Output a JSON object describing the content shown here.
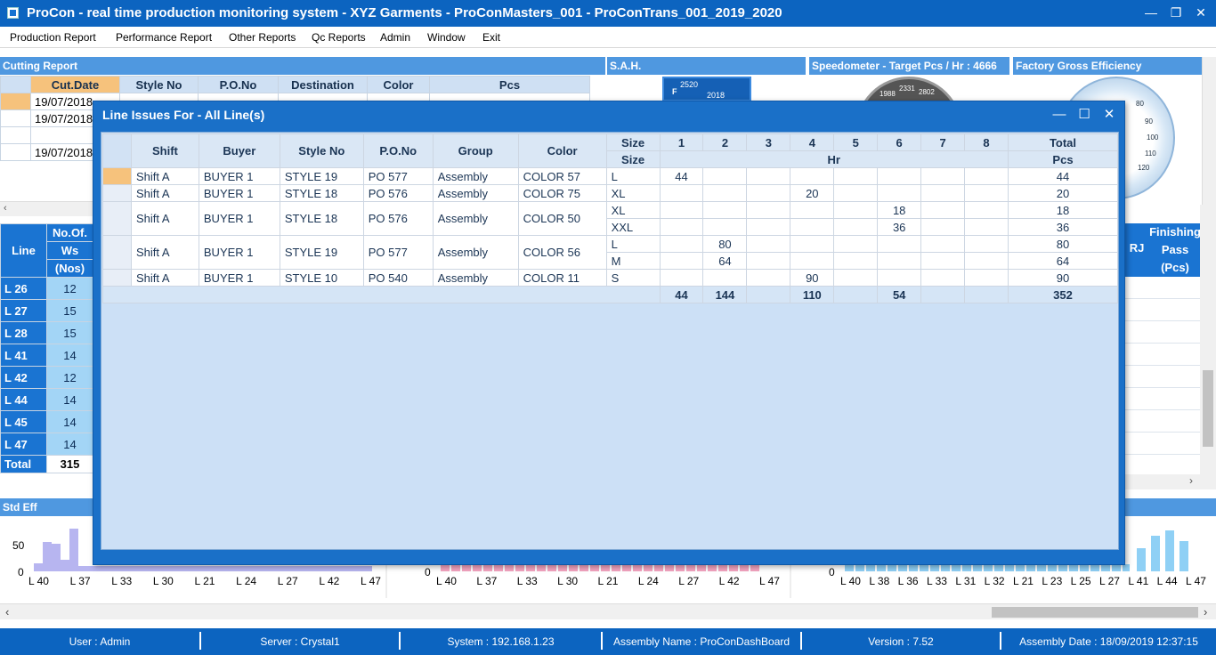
{
  "window": {
    "title": "ProCon - real time production monitoring system - XYZ Garments - ProConMasters_001 - ProConTrans_001_2019_2020",
    "minimize": "—",
    "restore": "❐",
    "close": "✕"
  },
  "menu": [
    "Production Report",
    "Performance Report",
    "Other Reports",
    "Qc Reports",
    "Admin",
    "Window",
    "Exit"
  ],
  "panels": {
    "cutting": "Cutting Report",
    "sah": "S.A.H.",
    "speedometer": "Speedometer - Target Pcs / Hr : 4666",
    "factory": "Factory Gross Efficiency",
    "std_eff": "Std Eff"
  },
  "cutting_table": {
    "headers": [
      "Cut.Date",
      "Style No",
      "P.O.No",
      "Destination",
      "Color",
      "Pcs"
    ],
    "rows": [
      [
        "19/07/2018",
        "",
        "",
        "",
        "",
        ""
      ],
      [
        "19/07/2018",
        "",
        "",
        "",
        "",
        ""
      ],
      [
        "",
        "",
        "",
        "",
        "",
        ""
      ],
      [
        "19/07/2018",
        "",
        "",
        "",
        "",
        ""
      ]
    ]
  },
  "sah_gauge": {
    "labels": [
      "2520",
      "F",
      "2018"
    ]
  },
  "speed_gauge": {
    "labels": [
      "1988",
      "2331",
      "2802"
    ]
  },
  "eff_gauge": {
    "labels": [
      "80",
      "90",
      "100",
      "110",
      "120"
    ]
  },
  "line_table": {
    "headers": [
      "Line",
      "No.Of.",
      "Ws",
      "(Nos)"
    ],
    "rows": [
      {
        "line": "L 26",
        "ws": "12"
      },
      {
        "line": "L 27",
        "ws": "15"
      },
      {
        "line": "L 28",
        "ws": "15"
      },
      {
        "line": "L 41",
        "ws": "14"
      },
      {
        "line": "L 42",
        "ws": "12"
      },
      {
        "line": "L 44",
        "ws": "14"
      },
      {
        "line": "L 45",
        "ws": "14"
      },
      {
        "line": "L 47",
        "ws": "14"
      }
    ],
    "total_label": "Total",
    "total_value": "315"
  },
  "right_table": {
    "header1": "Finishing",
    "header2": "Pass",
    "header3": "(Pcs)",
    "partial": "RJ"
  },
  "chart_left": {
    "ylabels": [
      "50",
      "0"
    ],
    "xlabels": [
      "L 40",
      "L 37",
      "L 33",
      "L 30",
      "L 21",
      "L 24",
      "L 27",
      "L 42",
      "L 47"
    ],
    "values": [
      15,
      55,
      52,
      22,
      80,
      10,
      10,
      10,
      10,
      10,
      10,
      10,
      10,
      10,
      10,
      10,
      10,
      10,
      10,
      10,
      10,
      10,
      10,
      10,
      10,
      10,
      10,
      10,
      10,
      10,
      10,
      10,
      10,
      10,
      10,
      10,
      10,
      10
    ],
    "color": "#b7b5f0"
  },
  "chart_mid": {
    "ylabels": [
      "0"
    ],
    "xlabels": [
      "L 40",
      "L 37",
      "L 33",
      "L 30",
      "L 21",
      "L 24",
      "L 27",
      "L 42",
      "L 47"
    ],
    "color": "#f4a4c0"
  },
  "chart_right": {
    "ylabels": [
      "0"
    ],
    "xlabels": [
      "L 40",
      "L 38",
      "L 36",
      "L 33",
      "L 31",
      "L 32",
      "L 21",
      "L 23",
      "L 25",
      "L 27",
      "L 41",
      "L 44",
      "L 47"
    ],
    "color": "#8fd0f5"
  },
  "modal": {
    "title": "Line Issues For - All Line(s)",
    "min": "—",
    "max": "☐",
    "close": "✕",
    "headers": [
      "Shift",
      "Buyer",
      "Style No",
      "P.O.No",
      "Group",
      "Color"
    ],
    "size_label": "Size",
    "hours": [
      "1",
      "2",
      "3",
      "4",
      "5",
      "6",
      "7",
      "8"
    ],
    "total_label": "Total",
    "hr_label": "Hr",
    "pcs_label": "Pcs",
    "rows": [
      {
        "shift": "Shift A",
        "buyer": "BUYER 1",
        "style": "STYLE 19",
        "po": "PO 577",
        "group": "Assembly",
        "color": "COLOR 57",
        "sizes": [
          {
            "size": "L",
            "h": [
              "44",
              "",
              "",
              "",
              "",
              "",
              "",
              ""
            ],
            "total": "44"
          }
        ]
      },
      {
        "shift": "Shift A",
        "buyer": "BUYER 1",
        "style": "STYLE 18",
        "po": "PO 576",
        "group": "Assembly",
        "color": "COLOR 75",
        "sizes": [
          {
            "size": "XL",
            "h": [
              "",
              "",
              "",
              "20",
              "",
              "",
              "",
              ""
            ],
            "total": "20"
          }
        ]
      },
      {
        "shift": "Shift A",
        "buyer": "BUYER 1",
        "style": "STYLE 18",
        "po": "PO 576",
        "group": "Assembly",
        "color": "COLOR 50",
        "sizes": [
          {
            "size": "XL",
            "h": [
              "",
              "",
              "",
              "",
              "",
              "18",
              "",
              ""
            ],
            "total": "18"
          },
          {
            "size": "XXL",
            "h": [
              "",
              "",
              "",
              "",
              "",
              "36",
              "",
              ""
            ],
            "total": "36"
          }
        ]
      },
      {
        "shift": "Shift A",
        "buyer": "BUYER 1",
        "style": "STYLE 19",
        "po": "PO 577",
        "group": "Assembly",
        "color": "COLOR 56",
        "sizes": [
          {
            "size": "L",
            "h": [
              "",
              "80",
              "",
              "",
              "",
              "",
              "",
              ""
            ],
            "total": "80"
          },
          {
            "size": "M",
            "h": [
              "",
              "64",
              "",
              "",
              "",
              "",
              "",
              ""
            ],
            "total": "64"
          }
        ]
      },
      {
        "shift": "Shift A",
        "buyer": "BUYER 1",
        "style": "STYLE 10",
        "po": "PO 540",
        "group": "Assembly",
        "color": "COLOR 11",
        "sizes": [
          {
            "size": "S",
            "h": [
              "",
              "",
              "",
              "90",
              "",
              "",
              "",
              ""
            ],
            "total": "90"
          }
        ]
      }
    ],
    "totals": [
      "44",
      "144",
      "",
      "110",
      "",
      "54",
      "",
      ""
    ],
    "grand_total": "352"
  },
  "status": {
    "user": "User : Admin",
    "server": "Server : Crystal1",
    "system": "System : 192.168.1.23",
    "assembly": "Assembly Name : ProConDashBoard",
    "version": "Version : 7.52",
    "date": "Assembly Date : 18/09/2019 12:37:15"
  }
}
